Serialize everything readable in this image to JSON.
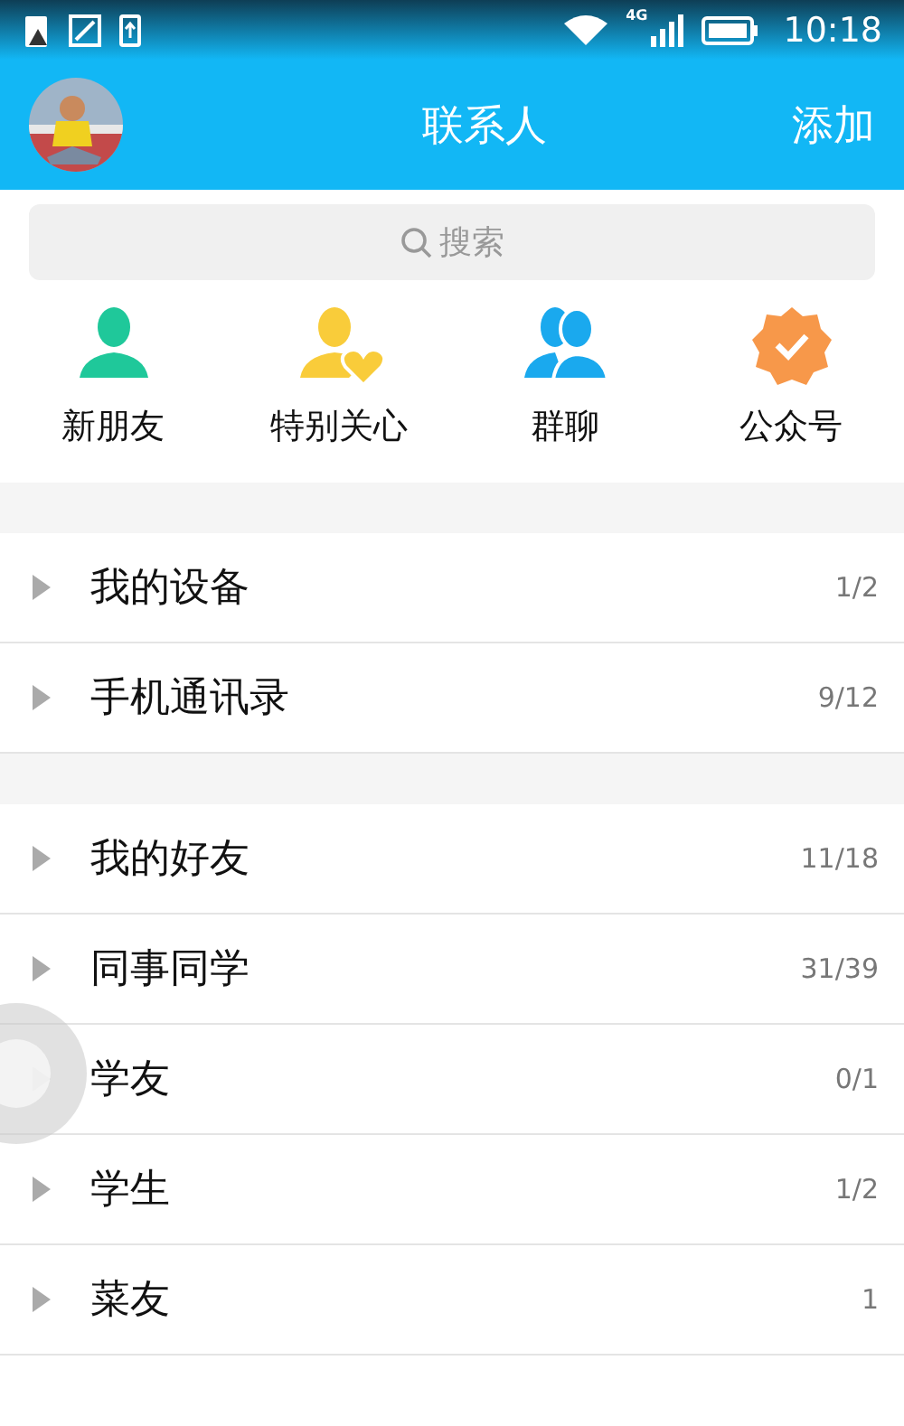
{
  "status_bar": {
    "time": "10:18",
    "network": "4G"
  },
  "header": {
    "title": "联系人",
    "action": "添加"
  },
  "search": {
    "placeholder": "搜索"
  },
  "shortcuts": [
    {
      "label": "新朋友",
      "kind": "person",
      "color": "#1fc89a"
    },
    {
      "label": "特别关心",
      "kind": "heart",
      "color": "#f9cc3a"
    },
    {
      "label": "群聊",
      "kind": "group",
      "color": "#1aa9ee"
    },
    {
      "label": "公众号",
      "kind": "badge",
      "color": "#f7984a"
    }
  ],
  "groups": [
    [
      {
        "name": "我的设备",
        "count": "1/2"
      },
      {
        "name": "手机通讯录",
        "count": "9/12"
      }
    ],
    [
      {
        "name": "我的好友",
        "count": "11/18"
      },
      {
        "name": "同事同学",
        "count": "31/39"
      },
      {
        "name": "学友",
        "count": "0/1"
      },
      {
        "name": "学生",
        "count": "1/2"
      },
      {
        "name": "菜友",
        "count": "1"
      }
    ]
  ],
  "floating_button": {
    "shown": true
  }
}
